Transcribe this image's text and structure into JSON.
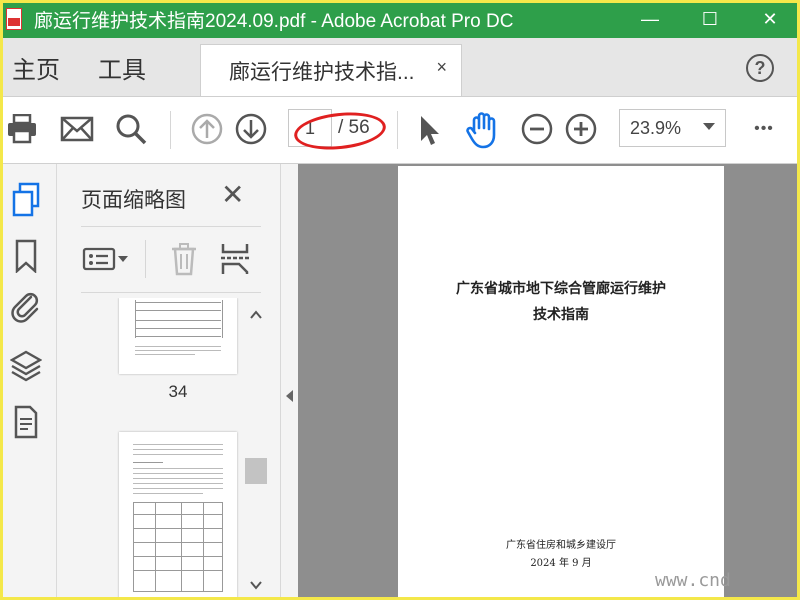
{
  "window": {
    "title": "廊运行维护技术指南2024.09.pdf - Adobe Acrobat Pro DC",
    "minimize_glyph": "—",
    "maximize_glyph": "☐",
    "close_glyph": "✕"
  },
  "tabs": {
    "home_label": "主页",
    "tools_label": "工具",
    "document_label": "廊运行维护技术指...",
    "close_glyph": "×",
    "help_glyph": "?"
  },
  "toolbar": {
    "current_page": "1",
    "page_total": "/ 56",
    "zoom": "23.9%",
    "more_glyph": "•••"
  },
  "thumbnail_panel": {
    "title": "页面缩略图",
    "close_glyph": "✕",
    "pages": [
      {
        "label": "34"
      },
      {
        "label": ""
      }
    ]
  },
  "document": {
    "title_line1": "广东省城市地下综合管廊运行维护",
    "title_line2": "技术指南",
    "publisher": "广东省住房和城乡建设厅",
    "date": "2024 年 9 月"
  },
  "watermark": "www.cnd",
  "colors": {
    "titlebar": "#2e9f4a",
    "accent_blue": "#1473e6",
    "annotation_red": "#e02020",
    "frame_yellow": "#f4e84a"
  }
}
